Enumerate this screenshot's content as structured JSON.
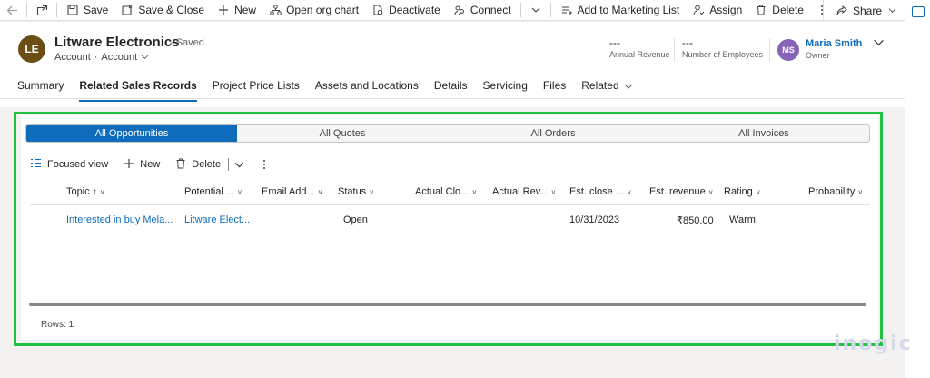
{
  "command_bar": {
    "back_icon": "arrow-left-icon",
    "open_icon": "open-in-window-icon",
    "items": [
      {
        "icon": "save-icon",
        "label": "Save"
      },
      {
        "icon": "save-close-icon",
        "label": "Save & Close"
      },
      {
        "icon": "plus-icon",
        "label": "New"
      },
      {
        "icon": "org-chart-icon",
        "label": "Open org chart"
      },
      {
        "icon": "deactivate-icon",
        "label": "Deactivate"
      },
      {
        "icon": "connect-icon",
        "label": "Connect"
      },
      {
        "icon": "marketing-list-icon",
        "label": "Add to Marketing List"
      },
      {
        "icon": "assign-icon",
        "label": "Assign"
      },
      {
        "icon": "delete-icon",
        "label": "Delete"
      }
    ],
    "share_label": "Share"
  },
  "header": {
    "avatar_initials": "LE",
    "avatar_color": "#6b4e16",
    "title": "Litware Electronics",
    "saved_status": "- Saved",
    "entity": "Account",
    "form": "Account",
    "fields": [
      {
        "value": "---",
        "label": "Annual Revenue"
      },
      {
        "value": "---",
        "label": "Number of Employees"
      }
    ],
    "owner": {
      "initials": "MS",
      "name": "Maria Smith",
      "label": "Owner",
      "color": "#8764b8"
    }
  },
  "tabs": [
    {
      "label": "Summary",
      "active": false
    },
    {
      "label": "Related Sales Records",
      "active": true
    },
    {
      "label": "Project Price Lists",
      "active": false
    },
    {
      "label": "Assets and Locations",
      "active": false
    },
    {
      "label": "Details",
      "active": false
    },
    {
      "label": "Servicing",
      "active": false
    },
    {
      "label": "Files",
      "active": false
    },
    {
      "label": "Related",
      "active": false
    }
  ],
  "segments": [
    {
      "label": "All Opportunities",
      "active": true
    },
    {
      "label": "All Quotes",
      "active": false
    },
    {
      "label": "All Orders",
      "active": false
    },
    {
      "label": "All Invoices",
      "active": false
    }
  ],
  "subgrid_commands": {
    "focused_view": "Focused view",
    "new": "New",
    "delete": "Delete"
  },
  "grid": {
    "columns": [
      "Topic",
      "Potential ...",
      "Email Add...",
      "Status",
      "Actual Clo...",
      "Actual Rev...",
      "Est. close ...",
      "Est. revenue",
      "Rating",
      "Probability"
    ],
    "sort_indicator": "↑",
    "rows": [
      {
        "topic": "Interested in buy Mela...",
        "potential": "Litware Elect...",
        "email": "",
        "status": "Open",
        "actual_close": "",
        "actual_revenue": "",
        "est_close": "10/31/2023",
        "est_revenue": "₹850.00",
        "rating": "Warm",
        "probability": ""
      }
    ],
    "rows_count": "Rows: 1"
  },
  "watermark": "inogic",
  "accent_color": "#0f6cbd",
  "highlight_color": "#22c043"
}
